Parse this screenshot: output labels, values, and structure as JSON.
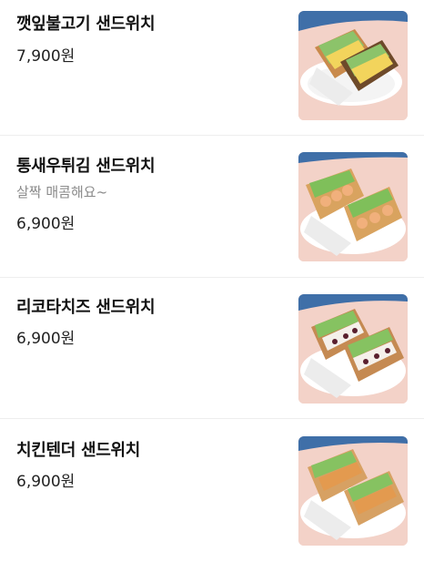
{
  "menu": {
    "items": [
      {
        "name": "깻잎불고기 샌드위치",
        "price": "7,900원",
        "image_icon": "sandwich-photo"
      },
      {
        "name": "통새우튀김 샌드위치",
        "description": "살짝 매콤해요~",
        "price": "6,900원",
        "image_icon": "sandwich-photo"
      },
      {
        "name": "리코타치즈 샌드위치",
        "price": "6,900원",
        "image_icon": "sandwich-photo"
      },
      {
        "name": "치킨텐더 샌드위치",
        "price": "6,900원",
        "image_icon": "sandwich-photo"
      }
    ]
  },
  "colors": {
    "photo_background": "#f3d2c8",
    "photo_accent_blue": "#3f6fa8",
    "divider": "#eeeeee",
    "description_text": "#8a8a8a"
  }
}
